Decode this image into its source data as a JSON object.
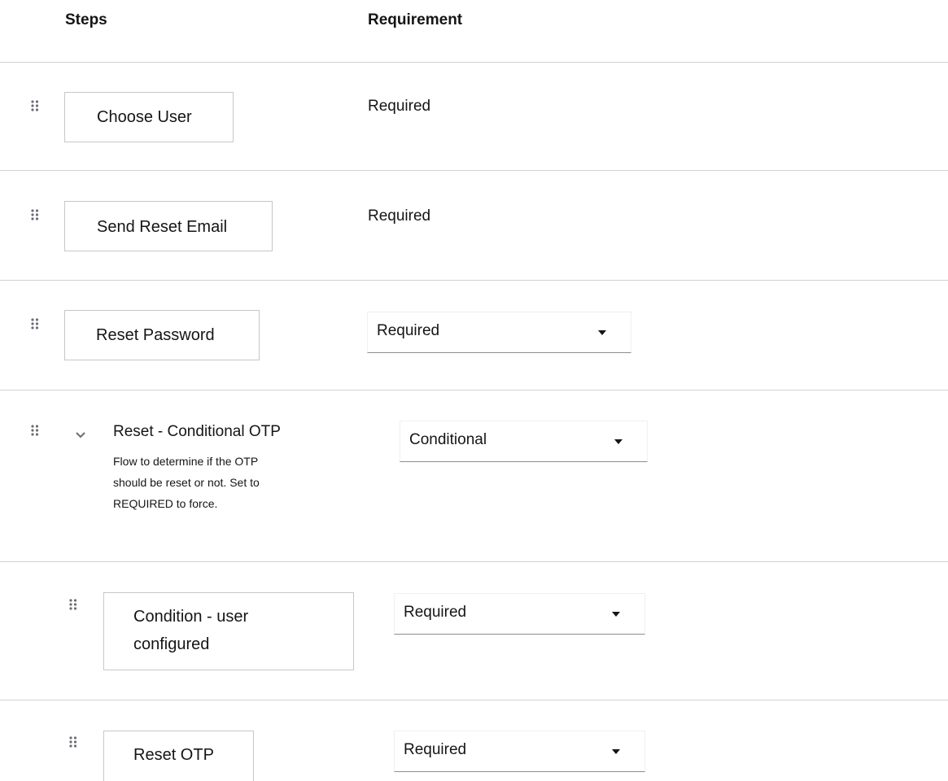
{
  "header": {
    "steps_label": "Steps",
    "requirement_label": "Requirement"
  },
  "rows": [
    {
      "step": "Choose User",
      "requirement": "Required",
      "requirement_editable": false
    },
    {
      "step": "Send Reset Email",
      "requirement": "Required",
      "requirement_editable": false
    },
    {
      "step": "Reset Password",
      "requirement": "Required",
      "requirement_editable": true
    },
    {
      "step": "Reset - Conditional OTP",
      "description_lines": [
        "Flow to determine if the OTP",
        "should be reset or not. Set to",
        "REQUIRED to force."
      ],
      "requirement": "Conditional",
      "requirement_editable": true,
      "expanded": true
    },
    {
      "step_lines": [
        "Condition - user",
        "configured"
      ],
      "requirement": "Required",
      "requirement_editable": true
    },
    {
      "step": "Reset OTP",
      "requirement": "Required",
      "requirement_editable": true
    }
  ],
  "icons": {
    "drag": "drag-handle-icon",
    "toggle": "chevron-down-icon",
    "caret": "caret-down-icon"
  }
}
